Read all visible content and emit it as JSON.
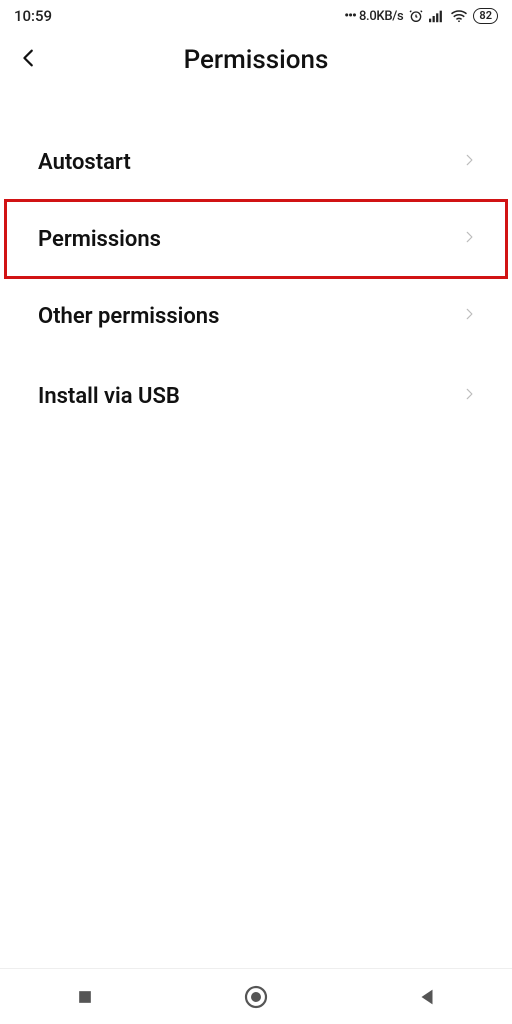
{
  "status": {
    "time": "10:59",
    "netspeed": "8.0KB/s",
    "battery": "82"
  },
  "header": {
    "title": "Permissions"
  },
  "list": {
    "items": [
      {
        "label": "Autostart",
        "highlighted": false
      },
      {
        "label": "Permissions",
        "highlighted": true
      },
      {
        "label": "Other permissions",
        "highlighted": false
      },
      {
        "label": "Install via USB",
        "highlighted": false
      }
    ]
  }
}
